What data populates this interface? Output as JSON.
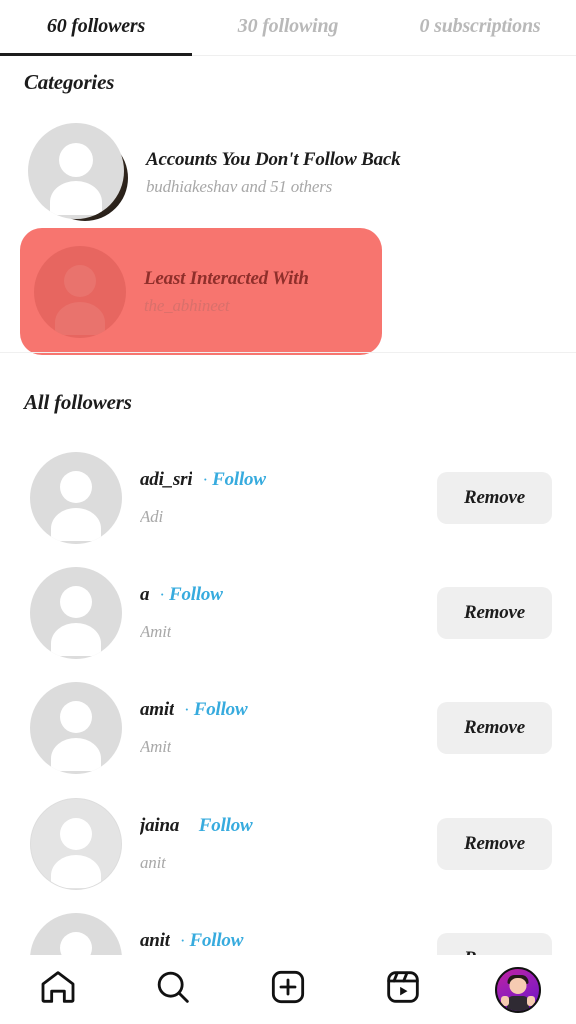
{
  "tabs": [
    {
      "label": "60 followers",
      "active": true
    },
    {
      "label": "30 following",
      "active": false
    },
    {
      "label": "0 subscriptions",
      "active": false
    }
  ],
  "sections": {
    "categories_title": "Categories",
    "all_followers_title": "All followers"
  },
  "categories": [
    {
      "title": "Accounts You Don't Follow Back",
      "subtitle": "budhiakeshav and 51 others",
      "highlighted": false
    },
    {
      "title": "Least Interacted With",
      "subtitle": "the_abhineet",
      "highlighted": true
    }
  ],
  "followers": [
    {
      "username": "adi_sri",
      "fullname": "Adi",
      "dot": "·",
      "follow_label": "Follow",
      "remove_label": "Remove"
    },
    {
      "username": "a",
      "fullname": "Amit",
      "dot": "·",
      "follow_label": "Follow",
      "remove_label": "Remove"
    },
    {
      "username": "amit",
      "fullname": "Amit",
      "dot": "·",
      "follow_label": "Follow",
      "remove_label": "Remove"
    },
    {
      "username": "jaina",
      "fullname": "anit",
      "dot": "·",
      "follow_label": "Follow",
      "remove_label": "Remove"
    },
    {
      "username": "anit",
      "fullname": "",
      "dot": "·",
      "follow_label": "Follow",
      "remove_label": "Remove"
    }
  ],
  "bottom_nav": [
    {
      "icon": "home-icon",
      "label": "Home"
    },
    {
      "icon": "search-icon",
      "label": "Search"
    },
    {
      "icon": "add-icon",
      "label": "Create"
    },
    {
      "icon": "reels-icon",
      "label": "Reels"
    },
    {
      "icon": "profile-avatar-icon",
      "label": "Profile"
    }
  ],
  "colors": {
    "accent_blue": "#37abde",
    "highlight_red": "#f7756f",
    "active_tab": "#1c1c1c",
    "inactive_tab": "#b9b9b9",
    "button_bg": "#efefef"
  }
}
